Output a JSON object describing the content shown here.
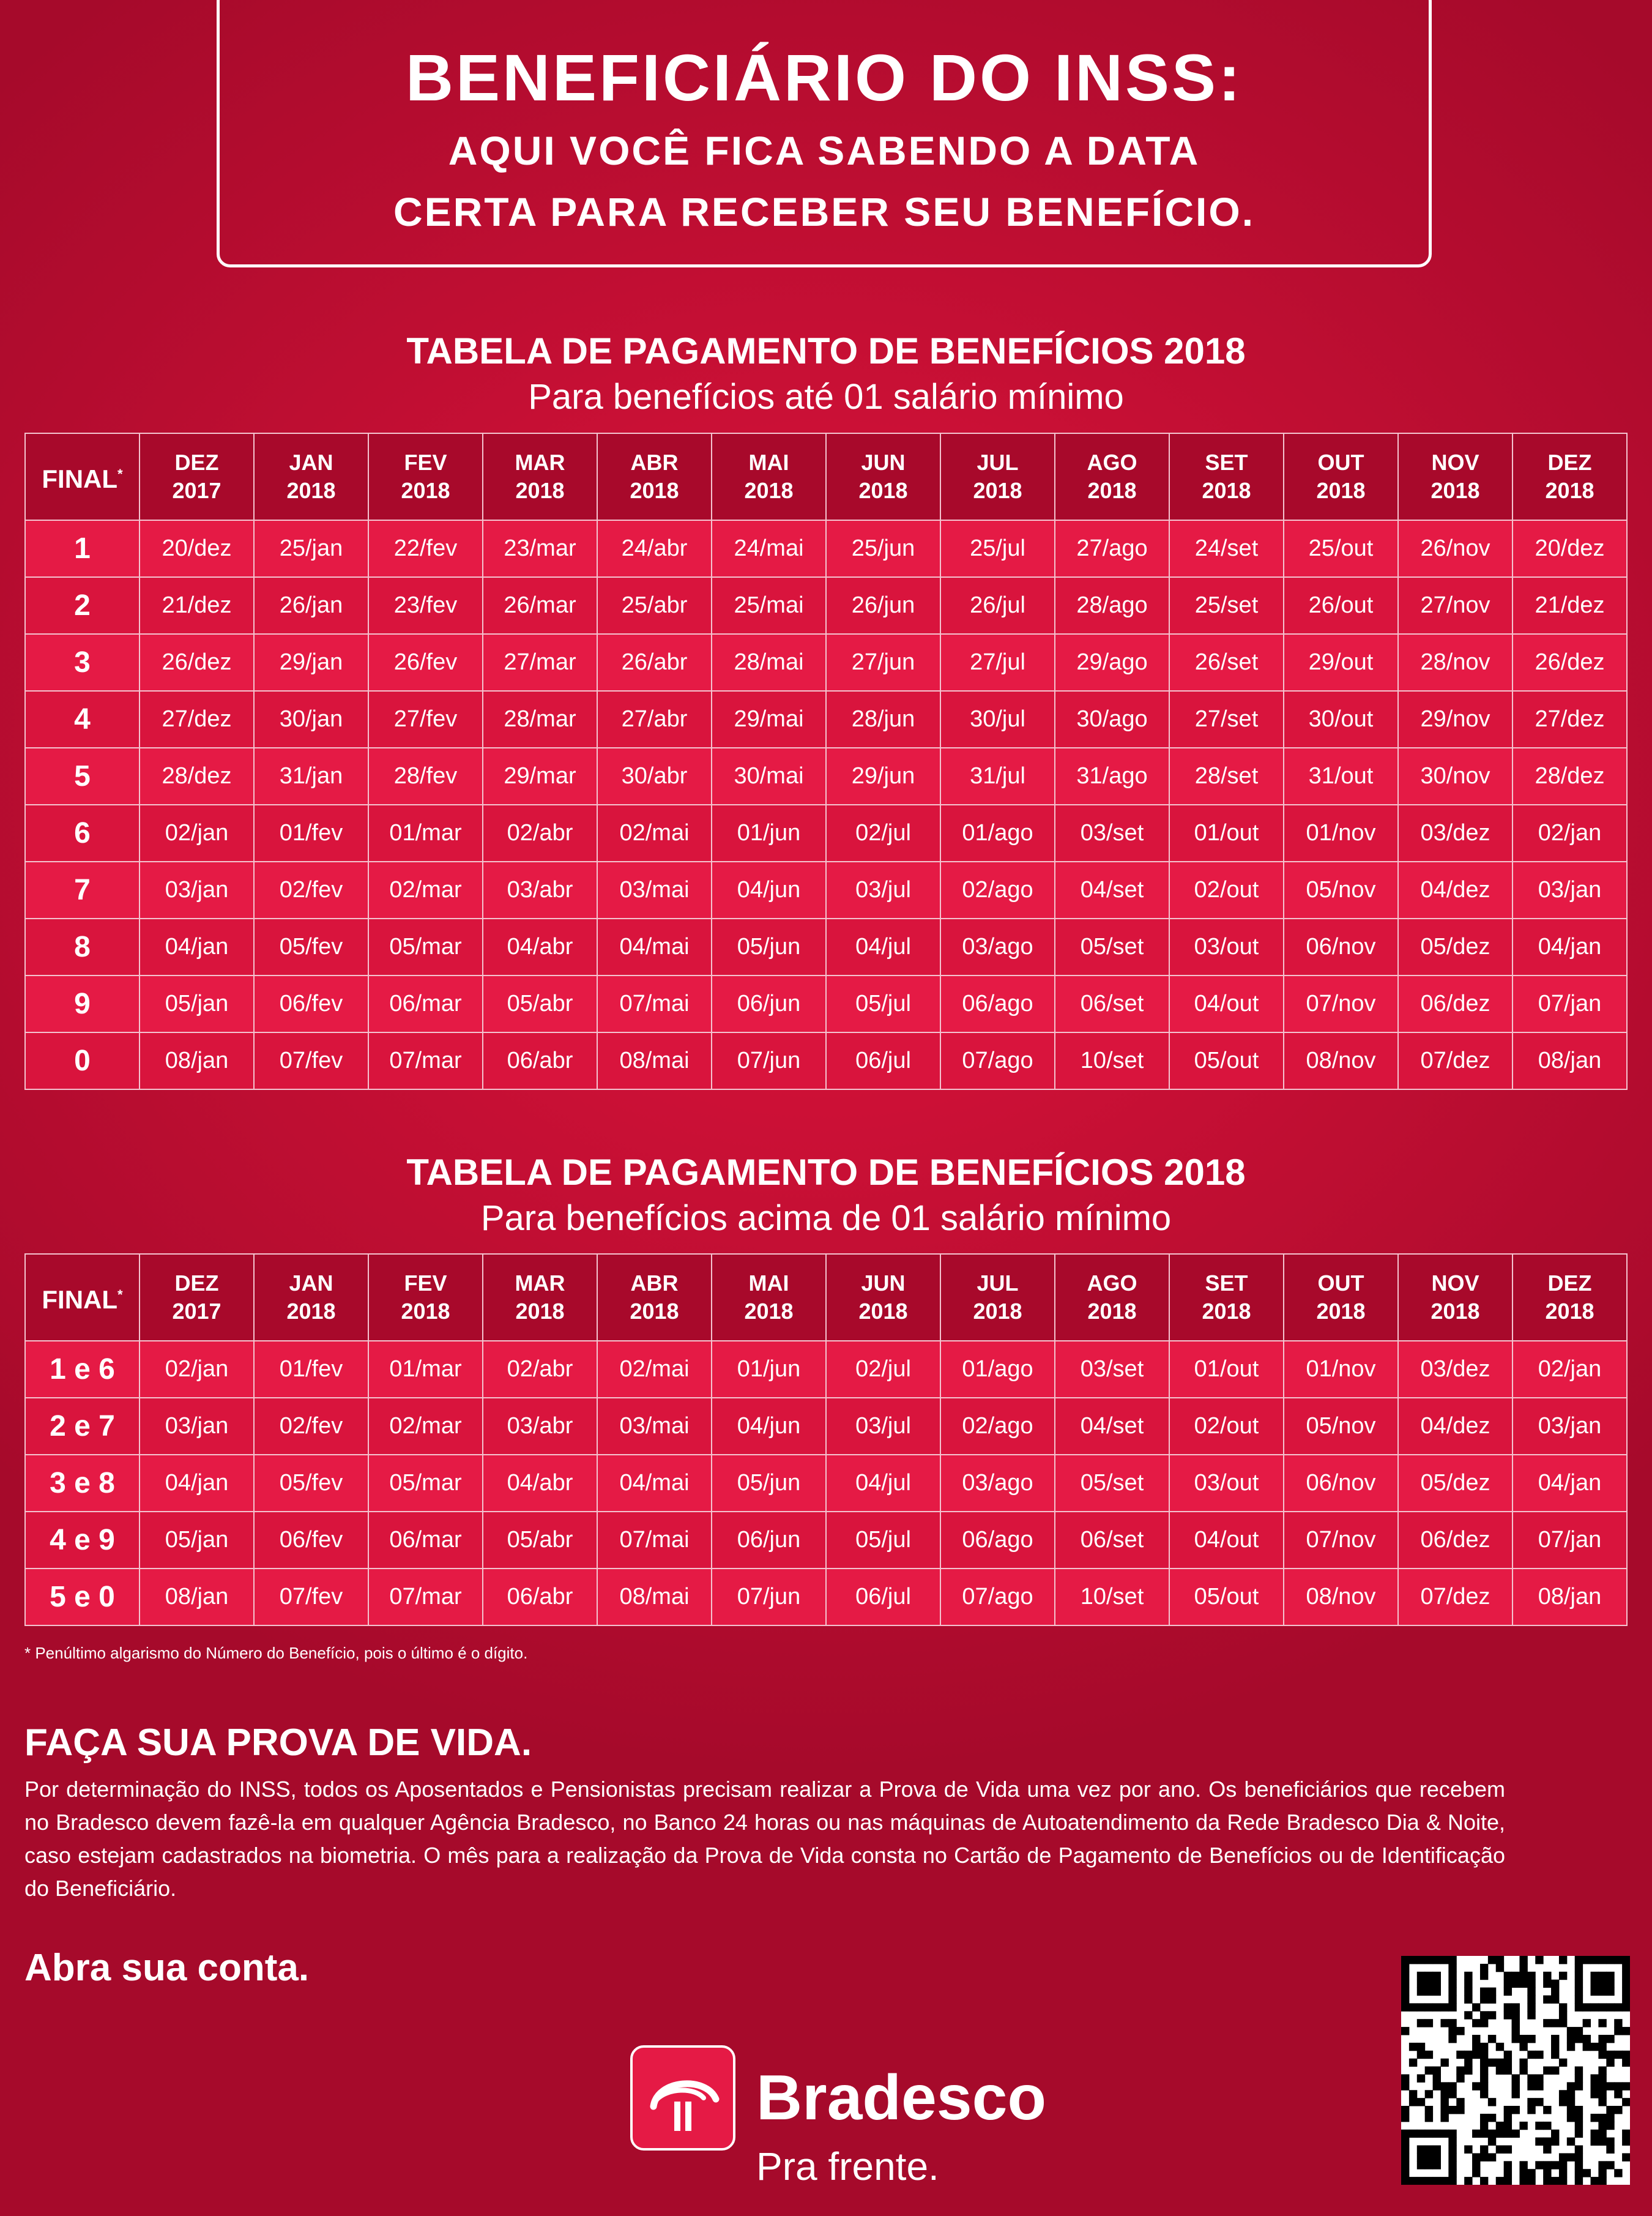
{
  "header": {
    "title": "BENEFICIÁRIO DO INSS:",
    "subtitle_line1": "AQUI VOCÊ FICA SABENDO A DATA",
    "subtitle_line2": "CERTA PARA RECEBER SEU BENEFÍCIO."
  },
  "table1": {
    "title": "TABELA DE PAGAMENTO DE BENEFÍCIOS 2018",
    "subtitle": "Para benefícios até 01 salário mínimo",
    "final_header": "FINAL",
    "final_marker": "*",
    "columns": [
      {
        "month": "DEZ",
        "year": "2017"
      },
      {
        "month": "JAN",
        "year": "2018"
      },
      {
        "month": "FEV",
        "year": "2018"
      },
      {
        "month": "MAR",
        "year": "2018"
      },
      {
        "month": "ABR",
        "year": "2018"
      },
      {
        "month": "MAI",
        "year": "2018"
      },
      {
        "month": "JUN",
        "year": "2018"
      },
      {
        "month": "JUL",
        "year": "2018"
      },
      {
        "month": "AGO",
        "year": "2018"
      },
      {
        "month": "SET",
        "year": "2018"
      },
      {
        "month": "OUT",
        "year": "2018"
      },
      {
        "month": "NOV",
        "year": "2018"
      },
      {
        "month": "DEZ",
        "year": "2018"
      }
    ],
    "rows": [
      {
        "final": "1",
        "dates": [
          "20/dez",
          "25/jan",
          "22/fev",
          "23/mar",
          "24/abr",
          "24/mai",
          "25/jun",
          "25/jul",
          "27/ago",
          "24/set",
          "25/out",
          "26/nov",
          "20/dez"
        ]
      },
      {
        "final": "2",
        "dates": [
          "21/dez",
          "26/jan",
          "23/fev",
          "26/mar",
          "25/abr",
          "25/mai",
          "26/jun",
          "26/jul",
          "28/ago",
          "25/set",
          "26/out",
          "27/nov",
          "21/dez"
        ]
      },
      {
        "final": "3",
        "dates": [
          "26/dez",
          "29/jan",
          "26/fev",
          "27/mar",
          "26/abr",
          "28/mai",
          "27/jun",
          "27/jul",
          "29/ago",
          "26/set",
          "29/out",
          "28/nov",
          "26/dez"
        ]
      },
      {
        "final": "4",
        "dates": [
          "27/dez",
          "30/jan",
          "27/fev",
          "28/mar",
          "27/abr",
          "29/mai",
          "28/jun",
          "30/jul",
          "30/ago",
          "27/set",
          "30/out",
          "29/nov",
          "27/dez"
        ]
      },
      {
        "final": "5",
        "dates": [
          "28/dez",
          "31/jan",
          "28/fev",
          "29/mar",
          "30/abr",
          "30/mai",
          "29/jun",
          "31/jul",
          "31/ago",
          "28/set",
          "31/out",
          "30/nov",
          "28/dez"
        ]
      },
      {
        "final": "6",
        "dates": [
          "02/jan",
          "01/fev",
          "01/mar",
          "02/abr",
          "02/mai",
          "01/jun",
          "02/jul",
          "01/ago",
          "03/set",
          "01/out",
          "01/nov",
          "03/dez",
          "02/jan"
        ]
      },
      {
        "final": "7",
        "dates": [
          "03/jan",
          "02/fev",
          "02/mar",
          "03/abr",
          "03/mai",
          "04/jun",
          "03/jul",
          "02/ago",
          "04/set",
          "02/out",
          "05/nov",
          "04/dez",
          "03/jan"
        ]
      },
      {
        "final": "8",
        "dates": [
          "04/jan",
          "05/fev",
          "05/mar",
          "04/abr",
          "04/mai",
          "05/jun",
          "04/jul",
          "03/ago",
          "05/set",
          "03/out",
          "06/nov",
          "05/dez",
          "04/jan"
        ]
      },
      {
        "final": "9",
        "dates": [
          "05/jan",
          "06/fev",
          "06/mar",
          "05/abr",
          "07/mai",
          "06/jun",
          "05/jul",
          "06/ago",
          "06/set",
          "04/out",
          "07/nov",
          "06/dez",
          "07/jan"
        ]
      },
      {
        "final": "0",
        "dates": [
          "08/jan",
          "07/fev",
          "07/mar",
          "06/abr",
          "08/mai",
          "07/jun",
          "06/jul",
          "07/ago",
          "10/set",
          "05/out",
          "08/nov",
          "07/dez",
          "08/jan"
        ]
      }
    ]
  },
  "table2": {
    "title": "TABELA DE PAGAMENTO DE BENEFÍCIOS 2018",
    "subtitle": "Para benefícios acima de 01 salário mínimo",
    "final_header": "FINAL",
    "final_marker": "*",
    "columns": [
      {
        "month": "DEZ",
        "year": "2017"
      },
      {
        "month": "JAN",
        "year": "2018"
      },
      {
        "month": "FEV",
        "year": "2018"
      },
      {
        "month": "MAR",
        "year": "2018"
      },
      {
        "month": "ABR",
        "year": "2018"
      },
      {
        "month": "MAI",
        "year": "2018"
      },
      {
        "month": "JUN",
        "year": "2018"
      },
      {
        "month": "JUL",
        "year": "2018"
      },
      {
        "month": "AGO",
        "year": "2018"
      },
      {
        "month": "SET",
        "year": "2018"
      },
      {
        "month": "OUT",
        "year": "2018"
      },
      {
        "month": "NOV",
        "year": "2018"
      },
      {
        "month": "DEZ",
        "year": "2018"
      }
    ],
    "rows": [
      {
        "final": "1 e 6",
        "dates": [
          "02/jan",
          "01/fev",
          "01/mar",
          "02/abr",
          "02/mai",
          "01/jun",
          "02/jul",
          "01/ago",
          "03/set",
          "01/out",
          "01/nov",
          "03/dez",
          "02/jan"
        ]
      },
      {
        "final": "2 e 7",
        "dates": [
          "03/jan",
          "02/fev",
          "02/mar",
          "03/abr",
          "03/mai",
          "04/jun",
          "03/jul",
          "02/ago",
          "04/set",
          "02/out",
          "05/nov",
          "04/dez",
          "03/jan"
        ]
      },
      {
        "final": "3 e 8",
        "dates": [
          "04/jan",
          "05/fev",
          "05/mar",
          "04/abr",
          "04/mai",
          "05/jun",
          "04/jul",
          "03/ago",
          "05/set",
          "03/out",
          "06/nov",
          "05/dez",
          "04/jan"
        ]
      },
      {
        "final": "4 e 9",
        "dates": [
          "05/jan",
          "06/fev",
          "06/mar",
          "05/abr",
          "07/mai",
          "06/jun",
          "05/jul",
          "06/ago",
          "06/set",
          "04/out",
          "07/nov",
          "06/dez",
          "07/jan"
        ]
      },
      {
        "final": "5 e 0",
        "dates": [
          "08/jan",
          "07/fev",
          "07/mar",
          "06/abr",
          "08/mai",
          "07/jun",
          "06/jul",
          "07/ago",
          "10/set",
          "05/out",
          "08/nov",
          "07/dez",
          "08/jan"
        ]
      }
    ]
  },
  "footnote": "* Penúltimo algarismo do Número do Benefício, pois o último é o dígito.",
  "proof_of_life": {
    "title": "FAÇA SUA PROVA DE VIDA.",
    "text": "Por determinação do INSS, todos os Aposentados e Pensionistas precisam realizar a Prova de Vida uma vez por ano. Os beneficiários que recebem no Bradesco devem fazê-la em qualquer Agência Bradesco, no Banco 24 horas ou nas máquinas de Autoatendimento da Rede Bradesco Dia & Noite, caso estejam cadastrados na biometria. O mês para a realização da Prova de Vida consta no Cartão de Pagamento de Benefícios ou de Identificação do Beneficiário."
  },
  "cta": "Abra sua conta.",
  "brand": {
    "name": "Bradesco",
    "slogan": "Pra frente.",
    "color": "#cc092f"
  },
  "qr_icon": "qr-code-icon"
}
